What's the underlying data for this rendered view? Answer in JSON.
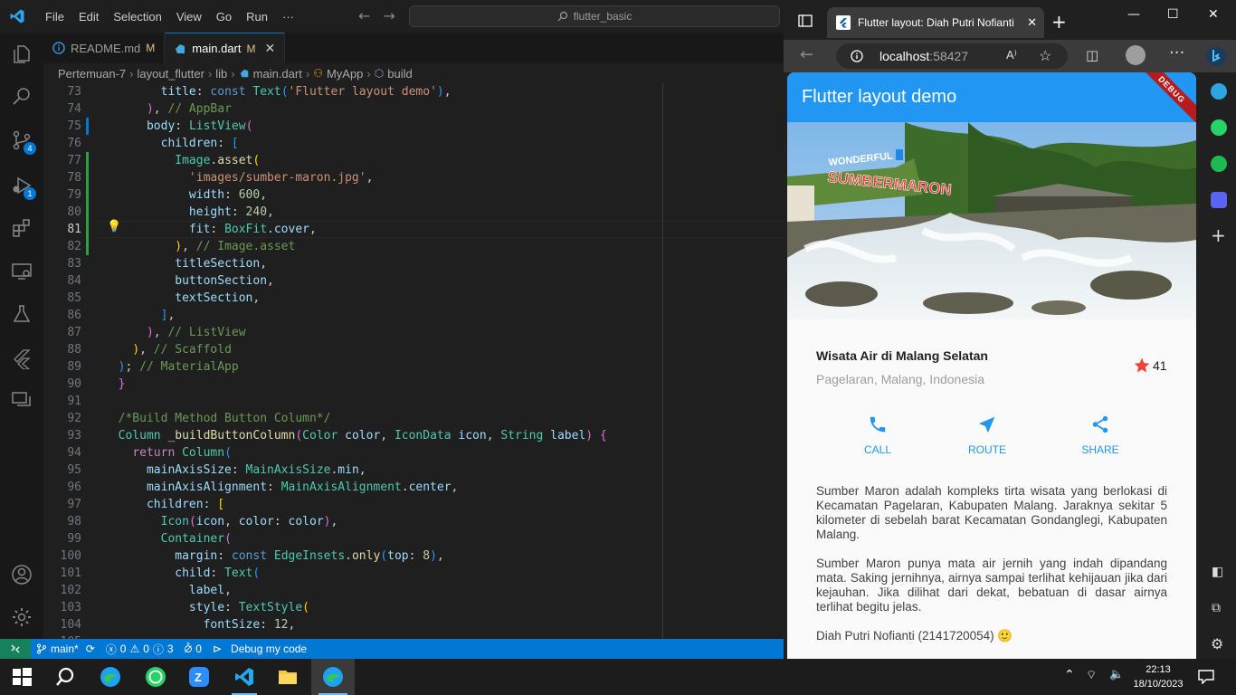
{
  "vscode": {
    "menu": [
      "File",
      "Edit",
      "Selection",
      "View",
      "Go",
      "Run",
      "···"
    ],
    "command_center": "flutter_basic",
    "tabs": [
      {
        "name": "README.md",
        "status": "M"
      },
      {
        "name": "main.dart",
        "status": "M"
      }
    ],
    "breadcrumb": [
      "Pertemuan-7",
      "layout_flutter",
      "lib",
      "main.dart",
      "MyApp",
      "build"
    ],
    "activity_badges": {
      "source_control": "4",
      "run_debug": "1"
    },
    "line_numbers": [
      "73",
      "74",
      "75",
      "76",
      "77",
      "78",
      "79",
      "80",
      "81",
      "82",
      "83",
      "84",
      "85",
      "86",
      "87",
      "88",
      "89",
      "90",
      "91",
      "92",
      "93",
      "94",
      "95",
      "96",
      "97",
      "98",
      "99",
      "100",
      "101",
      "102",
      "103",
      "104",
      "105"
    ],
    "current_line": "81",
    "status": {
      "branch": "main*",
      "errors": "0",
      "warnings": "0",
      "info": "3",
      "ports": "0",
      "debug": "Debug my code"
    }
  },
  "edge": {
    "tab_title": "Flutter layout: Diah Putri Nofianti",
    "url_host": "localhost",
    "url_port": ":58427"
  },
  "app": {
    "appbar_title": "Flutter layout demo",
    "debug_banner": "DEBUG",
    "sign_line1": "WONDERFUL",
    "sign_line2": "SUMBERMARON",
    "place_title": "Wisata Air di Malang Selatan",
    "place_location": "Pagelaran, Malang, Indonesia",
    "star_count": "41",
    "buttons": [
      {
        "icon": "phone-icon",
        "label": "CALL"
      },
      {
        "icon": "navigation-icon",
        "label": "ROUTE"
      },
      {
        "icon": "share-icon",
        "label": "SHARE"
      }
    ],
    "paragraph1": "Sumber Maron adalah kompleks tirta wisata yang berlokasi di Kecamatan Pagelaran, Kabupaten Malang. Jaraknya sekitar 5 kilometer di sebelah barat Kecamatan Gondanglegi, Kabupaten Malang.",
    "paragraph2": "Sumber Maron punya mata air jernih yang indah dipandang mata. Saking jernihnya, airnya sampai terlihat kehijauan jika dari kejauhan. Jika dilihat dari dekat, bebatuan di dasar airnya terlihat begitu jelas.",
    "author": "Diah Putri Nofianti (2141720054) 🙂",
    "accent_color": "#2196f3",
    "star_color": "#f44336"
  },
  "taskbar": {
    "time": "22:13",
    "date": "18/10/2023"
  }
}
